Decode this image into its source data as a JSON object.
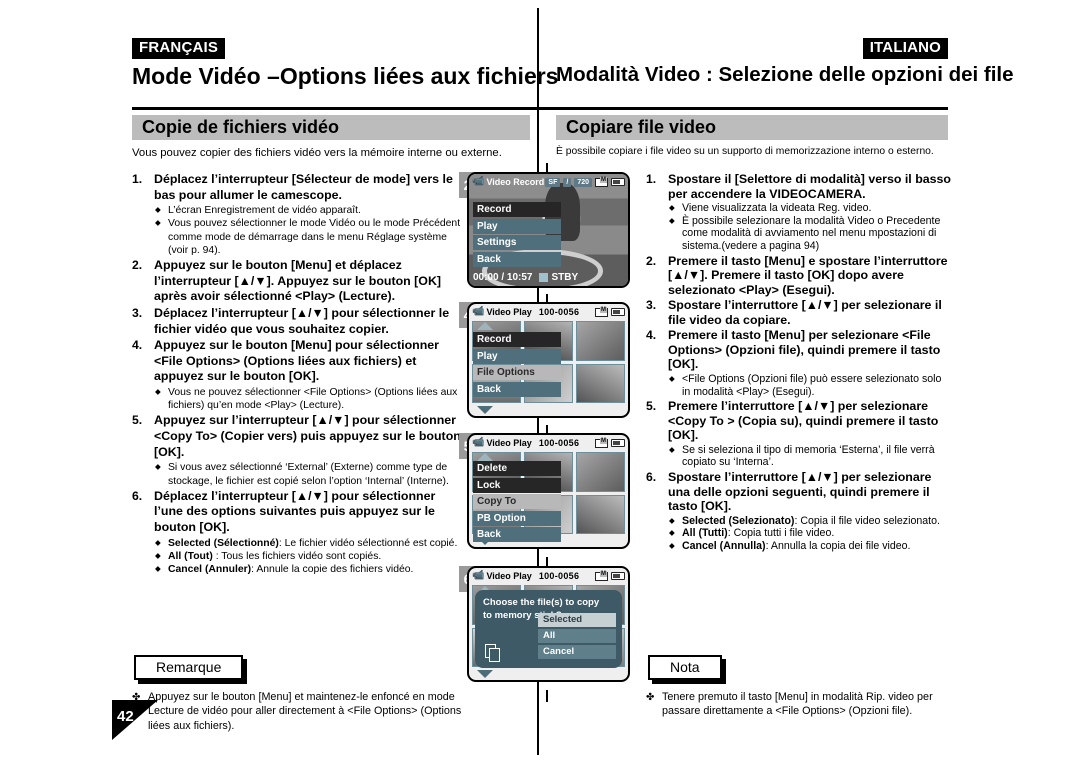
{
  "left": {
    "language": "FRANÇAIS",
    "title": "Mode Vidéo –Options liées aux fichiers",
    "section": "Copie de fichiers vidéo",
    "intro": "Vous pouvez copier des fichiers vidéo vers la mémoire interne ou externe.",
    "steps": [
      {
        "num": "1.",
        "head": "Déplacez l’interrupteur [Sélecteur de mode] vers le bas pour allumer le camescope.",
        "bullets": [
          "L’écran Enregistrement de vidéo apparaît.",
          "Vous pouvez sélectionner le mode Vidéo ou le mode Précédent comme mode de démarrage dans le menu Réglage système (voir p. 94)."
        ]
      },
      {
        "num": "2.",
        "head": "Appuyez sur le bouton [Menu] et déplacez l’interrupteur [▲/▼]. Appuyez sur le bouton [OK] après avoir sélectionné <Play> (Lecture).",
        "bullets": []
      },
      {
        "num": "3.",
        "head": "Déplacez l’interrupteur [▲/▼] pour sélectionner le fichier vidéo que vous souhaitez copier.",
        "bullets": []
      },
      {
        "num": "4.",
        "head": "Appuyez sur le bouton [Menu] pour sélectionner <File Options> (Options liées aux fichiers) et appuyez sur le bouton [OK].",
        "bullets": [
          "Vous ne pouvez sélectionner <File Options> (Options liées aux fichiers) qu’en mode <Play> (Lecture)."
        ]
      },
      {
        "num": "5.",
        "head": "Appuyez sur l’interrupteur [▲/▼] pour sélectionner <Copy To> (Copier vers) puis appuyez sur le bouton [OK].",
        "bullets": [
          "Si vous avez sélectionné ‘External’ (Externe) comme type de stockage, le fichier est copié selon l’option ‘Internal’ (Interne)."
        ]
      },
      {
        "num": "6.",
        "head": "Déplacez l’interrupteur [▲/▼] pour sélectionner l’une des options suivantes puis appuyez sur le bouton [OK].",
        "bullets": [
          "Selected (Sélectionné): Le fichier vidéo sélectionné est copié.",
          "All (Tout) : Tous les fichiers vidéo sont copiés.",
          "Cancel (Annuler): Annule la copie des fichiers vidéo."
        ],
        "bullets_bold_prefix": [
          "Selected (Sélectionné)",
          "All (Tout)",
          "Cancel (Annuler)"
        ]
      }
    ],
    "note_label": "Remarque",
    "note_mark": "✤",
    "note_text": "Appuyez sur le bouton [Menu] et maintenez-le enfoncé en mode Lecture de vidéo pour aller directement à <File Options> (Options liées aux fichiers)."
  },
  "right": {
    "language": "ITALIANO",
    "title": "Modalità Video : Selezione delle opzioni dei file",
    "section": "Copiare file video",
    "intro": "È possibile copiare i file video su un supporto di memorizzazione interno o esterno.",
    "steps": [
      {
        "num": "1.",
        "head": "Spostare il [Selettore di modalità] verso il basso per accendere la VIDEOCAMERA.",
        "bullets": [
          "Viene visualizzata la videata Reg. video.",
          "È possibile selezionare la modalità Video o Precedente come modalità di avviamento nel menu mpostazioni di sistema.(vedere a pagina 94)"
        ]
      },
      {
        "num": "2.",
        "head": "Premere il tasto [Menu] e spostare l’interruttore [▲/▼]. Premere il tasto [OK] dopo avere selezionato <Play> (Esegui).",
        "bullets": []
      },
      {
        "num": "3.",
        "head": "Spostare l’interruttore [▲/▼] per selezionare il file video da copiare.",
        "bullets": []
      },
      {
        "num": "4.",
        "head": "Premere il tasto [Menu] per selezionare <File Options> (Opzioni file), quindi premere il tasto [OK].",
        "bullets": [
          "<File Options (Opzioni file) può essere selezionato solo in modalità <Play> (Esegui)."
        ]
      },
      {
        "num": "5.",
        "head": "Premere l’interruttore [▲/▼] per selezionare <Copy To > (Copia su), quindi premere il tasto [OK].",
        "bullets": [
          "Se si seleziona il tipo di memoria ‘Esterna’, il file verrà copiato su ‘Interna’."
        ]
      },
      {
        "num": "6.",
        "head": "Spostare l’interruttore [▲/▼] per selezionare una delle opzioni seguenti, quindi premere il tasto [OK].",
        "bullets": [
          "Selected (Selezionato): Copia il file video selezionato.",
          "All (Tutti): Copia tutti i file video.",
          "Cancel (Annulla): Annulla la copia dei file video."
        ],
        "bullets_bold_prefix": [
          "Selected (Selezionato)",
          "All (Tutti)",
          "Cancel (Annulla)"
        ]
      }
    ],
    "note_label": "Nota",
    "note_mark": "✤",
    "note_text": "Tenere premuto il tasto [Menu] in modalità Rip. video per passare direttamente a <File Options> (Opzioni file)."
  },
  "screens": [
    {
      "badge": "2",
      "title": "Video Record",
      "file": "",
      "chips": [
        "SF",
        "/",
        "720"
      ],
      "menu": [
        {
          "label": "Record",
          "state": "dark"
        },
        {
          "label": "Play",
          "state": "normal"
        },
        {
          "label": "Settings",
          "state": "normal"
        },
        {
          "label": "Back",
          "state": "normal"
        }
      ],
      "status_time": "00:00 / 10:57",
      "status_mode": "STBY"
    },
    {
      "badge": "4",
      "title": "Video Play",
      "file": "100-0056",
      "menu": [
        {
          "label": "Record",
          "state": "dark"
        },
        {
          "label": "Play",
          "state": "normal"
        },
        {
          "label": "File Options",
          "state": "sel"
        },
        {
          "label": "Back",
          "state": "normal"
        }
      ]
    },
    {
      "badge": "5",
      "title": "Video Play",
      "file": "100-0056",
      "menu": [
        {
          "label": "Delete",
          "state": "dark"
        },
        {
          "label": "Lock",
          "state": "dark"
        },
        {
          "label": "Copy To",
          "state": "sel"
        },
        {
          "label": "PB Option",
          "state": "normal"
        },
        {
          "label": "Back",
          "state": "normal"
        }
      ]
    },
    {
      "badge": "6",
      "title": "Video Play",
      "file": "100-0056",
      "dialog": {
        "text_line1": "Choose the file(s) to copy",
        "text_line2": "to memory stick?",
        "options": [
          {
            "label": "Selected",
            "state": "sel"
          },
          {
            "label": "All",
            "state": "normal"
          },
          {
            "label": "Cancel",
            "state": "normal"
          }
        ]
      }
    }
  ],
  "page_number": "42",
  "colors": {
    "section_bar": "#bcbcbc",
    "badge": "#9a9a9a",
    "menu_normal": "#4e6f7b",
    "menu_dark": "#262626",
    "menu_selected": "#b8b8b8",
    "dialog_bg": "#3d5a66"
  }
}
